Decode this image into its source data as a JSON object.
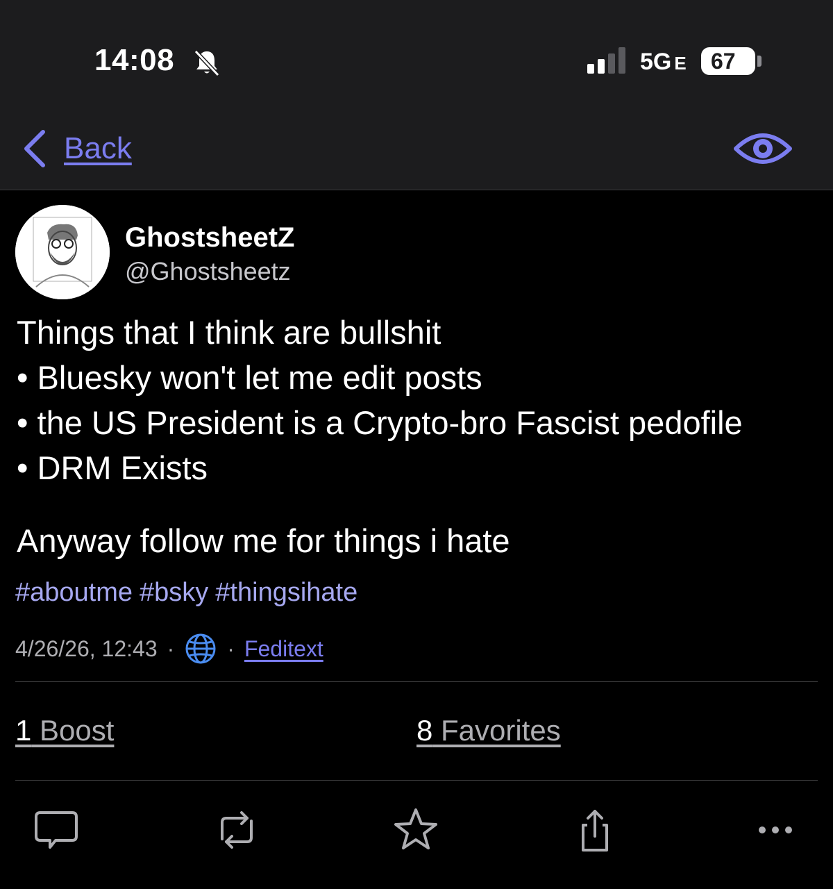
{
  "status_bar": {
    "time": "14:08",
    "network": "5G",
    "network_suffix": "E",
    "battery": "67",
    "icons": [
      "bell-slash-icon",
      "signal-icon"
    ]
  },
  "nav": {
    "back_label": "Back",
    "right_icon": "eye-icon",
    "accent_color": "#7b7df0"
  },
  "author": {
    "display_name": "GhostsheetZ",
    "handle": "@Ghostsheetz"
  },
  "post": {
    "intro": "Things that I think are bullshit",
    "bullets": [
      "• Bluesky won't let me edit posts",
      "• the US President is a Crypto-bro Fascist pedofile",
      "• DRM Exists"
    ],
    "closing": "Anyway follow me for things i hate"
  },
  "hashtags": [
    "#aboutme",
    "#bsky",
    "#thingsihate"
  ],
  "meta": {
    "timestamp": "4/26/26, 12:43",
    "separator": "·",
    "visibility_icon": "globe-icon",
    "client": "Feditext"
  },
  "stats": {
    "boosts_count": "1",
    "boosts_label": " Boost",
    "favorites_count": "8",
    "favorites_label": " Favorites"
  },
  "actions": [
    "reply-icon",
    "boost-icon",
    "favorite-icon",
    "share-icon",
    "more-icon"
  ]
}
